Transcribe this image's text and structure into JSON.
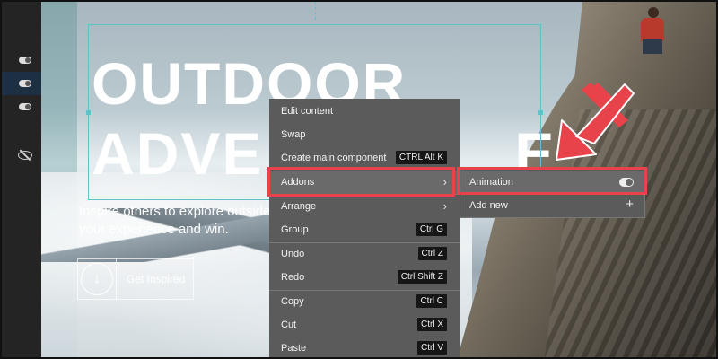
{
  "canvas": {
    "headline_line1": "OUTDOOR",
    "headline_line2": "ADVE",
    "headline_line2_tail": "E",
    "tagline": "Inspire others to explore outside your experience and win.",
    "cta_label": "Get Inspired",
    "cta_icon": "arrow-down-icon"
  },
  "layers": [
    {
      "icon": "toggle-icon"
    },
    {
      "icon": "toggle-icon",
      "active": true
    },
    {
      "icon": "toggle-icon"
    },
    {
      "icon": "eye-slash-icon"
    }
  ],
  "context_menu": {
    "items": [
      {
        "label": "Edit content",
        "shortcut": ""
      },
      {
        "label": "Swap",
        "shortcut": ""
      },
      {
        "label": "Create main component",
        "shortcut": "CTRL Alt K"
      },
      {
        "label": "Addons",
        "shortcut": "",
        "submenu": true
      },
      {
        "label": "Arrange",
        "shortcut": "",
        "submenu": true
      },
      {
        "label": "Group",
        "shortcut": "Ctrl G"
      },
      {
        "label": "Undo",
        "shortcut": "Ctrl Z"
      },
      {
        "label": "Redo",
        "shortcut": "Ctrl Shift Z"
      },
      {
        "label": "Copy",
        "shortcut": "Ctrl C"
      },
      {
        "label": "Cut",
        "shortcut": "Ctrl X"
      },
      {
        "label": "Paste",
        "shortcut": "Ctrl V"
      }
    ]
  },
  "submenu": {
    "items": [
      {
        "label": "Animation",
        "control": "toggle-icon"
      },
      {
        "label": "Add new",
        "control": "plus-icon"
      }
    ]
  },
  "colors": {
    "highlight": "#e8434b",
    "menu_bg": "#5b5b5b",
    "selection": "#5fc2c8"
  }
}
